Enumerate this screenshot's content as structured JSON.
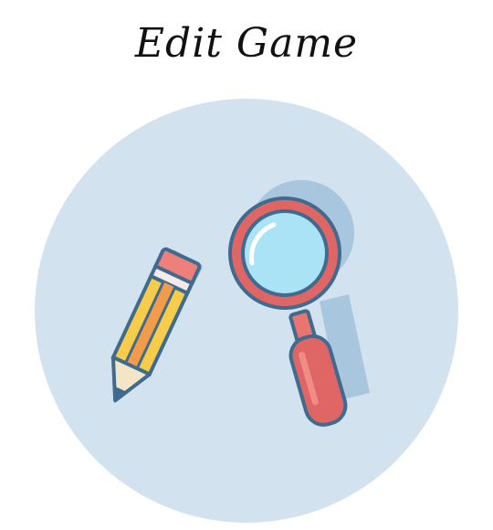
{
  "page": {
    "title": "Edit Game"
  },
  "icons": {
    "pencil": "pencil-icon",
    "magnifier": "magnifying-glass-icon"
  },
  "colors": {
    "background": "#ffffff",
    "circle": "#d3e2ef",
    "shadow": "#a9c6df",
    "outline": "#3f6b8f",
    "pencil_yellow": "#f7cc4a",
    "pencil_orange": "#f29c4a",
    "eraser": "#ee7f7b",
    "lens_ring": "#e06666",
    "lens_glass": "#a9e3f5",
    "handle": "#e06666",
    "wood": "#f4e5c6"
  }
}
